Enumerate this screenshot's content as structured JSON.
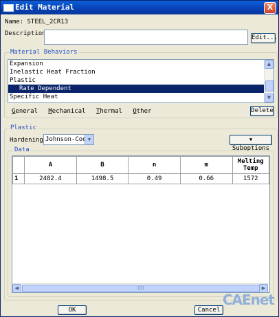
{
  "window": {
    "title": "Edit Material",
    "close_glyph": "X"
  },
  "name_line": "Name: STEEL_2CR13",
  "description": {
    "label": "Description:",
    "value": "",
    "edit_button": "Edit..."
  },
  "behaviors": {
    "group_label": "Material Behaviors",
    "items": [
      "Expansion",
      "Inelastic Heat Fraction",
      "Plastic",
      "Rate Dependent",
      "Specific Heat"
    ],
    "selected_index": 3,
    "menus": [
      "General",
      "Mechanical",
      "Thermal",
      "Other"
    ],
    "menu_accels": [
      "G",
      "M",
      "T",
      "O"
    ],
    "delete_button": "Delete"
  },
  "plastic": {
    "group_label": "Plastic",
    "hardening_label": "Hardening:",
    "hardening_value": "Johnson-Cook",
    "suboptions_button": "Suboptions",
    "data_label": "Data",
    "columns": [
      "",
      "A",
      "B",
      "n",
      "m",
      "Melting Temp"
    ],
    "rows": [
      [
        "1",
        "2482.4",
        "1498.5",
        "0.49",
        "0.66",
        "1572"
      ]
    ],
    "hscroll_thumb_glyph": "III"
  },
  "footer": {
    "ok": "OK",
    "cancel": "Cancel"
  },
  "watermark": "CAEnet",
  "colors": {
    "titlebar": "#0841b3",
    "selection": "#0a246a",
    "group_label": "#2150c4"
  },
  "icons": {
    "arrow_up": "▲",
    "arrow_down": "▼",
    "arrow_left": "◀",
    "arrow_right": "▶",
    "dropdown": "▼"
  }
}
